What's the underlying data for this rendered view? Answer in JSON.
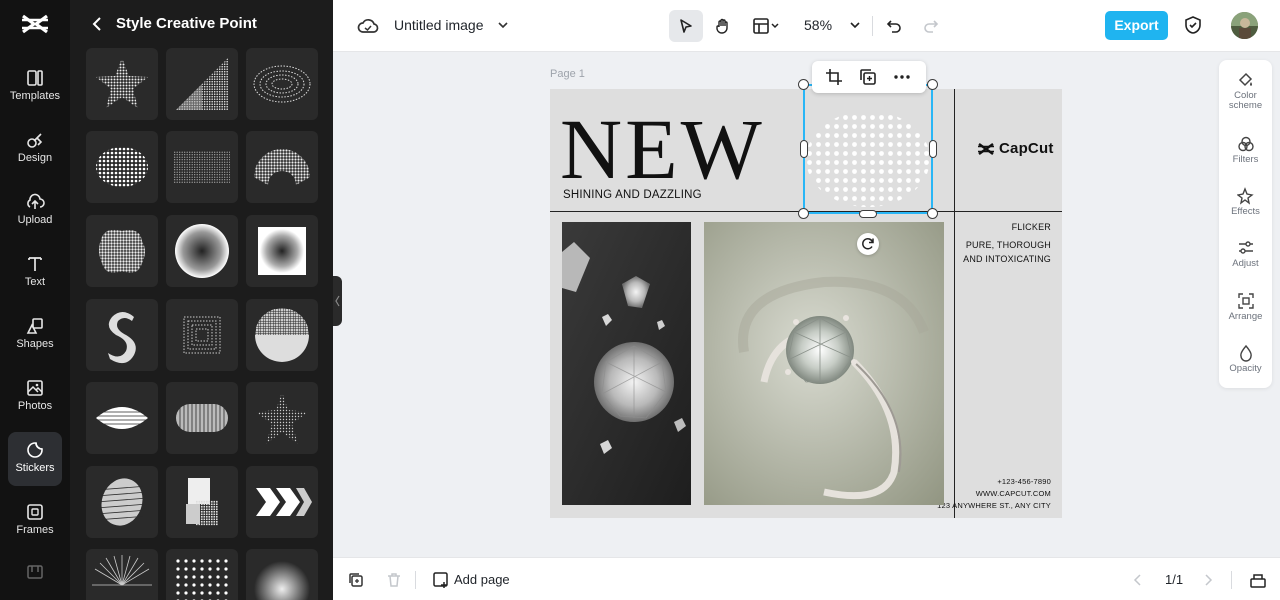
{
  "rail": {
    "items": [
      {
        "label": "Templates",
        "icon": "templates-icon"
      },
      {
        "label": "Design",
        "icon": "design-icon"
      },
      {
        "label": "Upload",
        "icon": "upload-icon"
      },
      {
        "label": "Text",
        "icon": "text-icon"
      },
      {
        "label": "Shapes",
        "icon": "shapes-icon"
      },
      {
        "label": "Photos",
        "icon": "photos-icon"
      },
      {
        "label": "Stickers",
        "icon": "stickers-icon",
        "active": true
      },
      {
        "label": "Frames",
        "icon": "frames-icon"
      }
    ]
  },
  "panel": {
    "title": "Style Creative Point",
    "stickers": [
      "star-halftone",
      "triangle-halftone",
      "ellipse-rings",
      "oval-dots",
      "rect-dots",
      "arch-halftone",
      "blob-halftone",
      "circle-halftone",
      "square-halftone",
      "s-shape",
      "square-frames",
      "half-circle",
      "diamond-lines",
      "pill-lines",
      "star-dots",
      "sphere-lines",
      "blocks",
      "chevrons",
      "burst",
      "polka-dots",
      "radial-glow"
    ]
  },
  "topbar": {
    "doc_title": "Untitled image",
    "zoom": "58%",
    "export_label": "Export"
  },
  "canvas": {
    "page_label": "Page 1",
    "headline": "NEW",
    "tagline": "SHINING AND DAZZLING",
    "brand": "CapCut",
    "side_text": [
      "FLICKER",
      "PURE, THOROUGH",
      "AND INTOXICATING"
    ],
    "contact": [
      "+123-456-7890",
      "WWW.CAPCUT.COM",
      "123 ANYWHERE ST., ANY CITY"
    ]
  },
  "right_panel": {
    "items": [
      {
        "label": "Color\nscheme",
        "icon": "color-scheme-icon"
      },
      {
        "label": "Filters",
        "icon": "filters-icon"
      },
      {
        "label": "Effects",
        "icon": "effects-icon"
      },
      {
        "label": "Adjust",
        "icon": "adjust-icon"
      },
      {
        "label": "Arrange",
        "icon": "arrange-icon"
      },
      {
        "label": "Opacity",
        "icon": "opacity-icon"
      }
    ]
  },
  "bottombar": {
    "add_page_label": "Add page",
    "pager": "1/1"
  },
  "colors": {
    "accent": "#1fb4f0",
    "selection": "#29b6f6",
    "rail_bg": "#121212",
    "panel_bg": "#1c1c1c"
  }
}
